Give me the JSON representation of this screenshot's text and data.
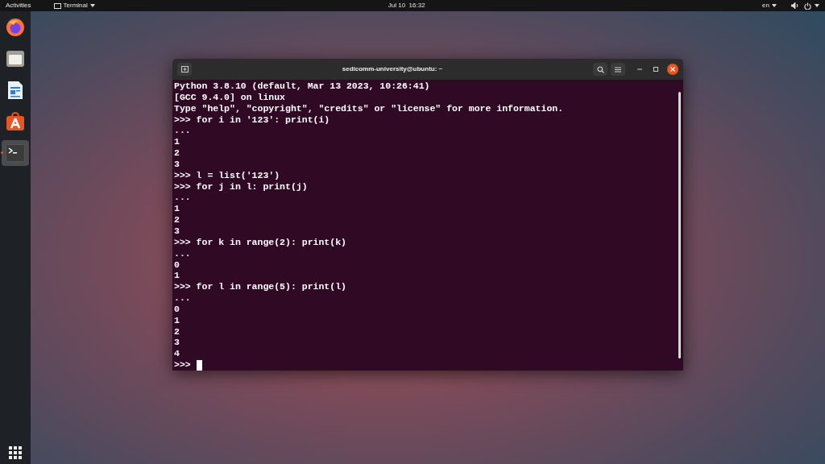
{
  "top_bar": {
    "activities": "Activities",
    "app_menu": "Terminal",
    "clock": "Jul 10  16:32",
    "language": "en"
  },
  "dock": {
    "items": [
      {
        "kind": "browser",
        "selected": false
      },
      {
        "kind": "files",
        "selected": false
      },
      {
        "kind": "writer",
        "selected": false
      },
      {
        "kind": "store",
        "selected": false
      },
      {
        "kind": "terminal",
        "selected": true
      }
    ]
  },
  "terminal": {
    "title": "sedicomm-university@ubuntu: ~",
    "lines": [
      "Python 3.8.10 (default, Mar 13 2023, 10:26:41)",
      "[GCC 9.4.0] on linux",
      "Type \"help\", \"copyright\", \"credits\" or \"license\" for more information.",
      ">>> for i in '123': print(i)",
      "...",
      "1",
      "2",
      "3",
      ">>> l = list('123')",
      ">>> for j in l: print(j)",
      "...",
      "1",
      "2",
      "3",
      ">>> for k in range(2): print(k)",
      "...",
      "0",
      "1",
      ">>> for l in range(5): print(l)",
      "...",
      "0",
      "1",
      "2",
      "3",
      "4"
    ],
    "prompt": ">>>"
  }
}
